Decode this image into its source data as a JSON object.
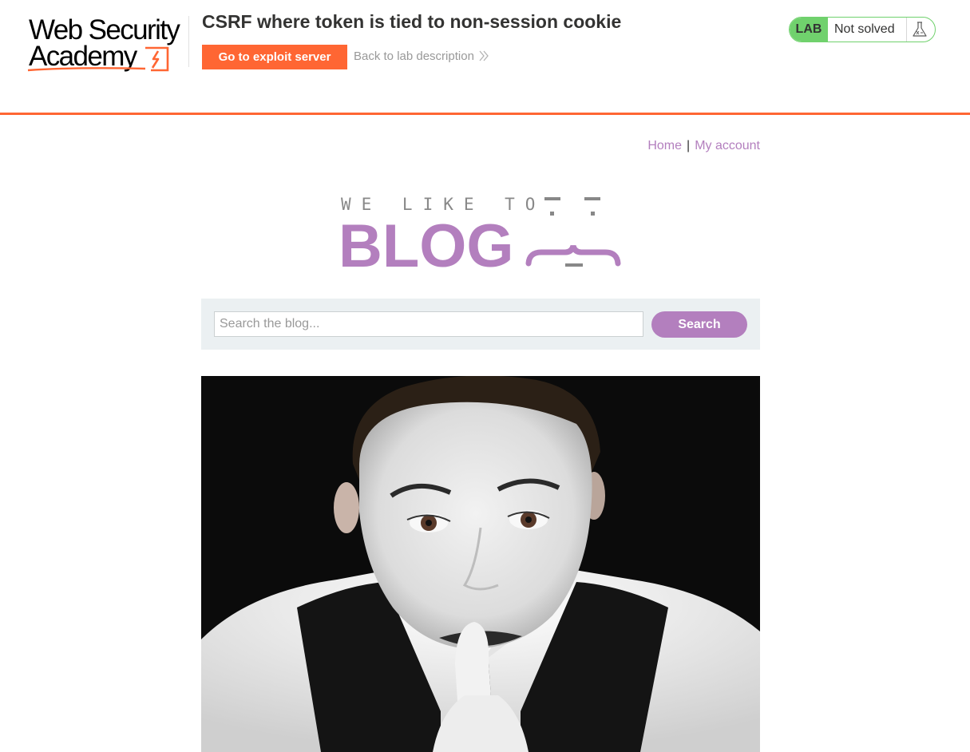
{
  "header": {
    "logo_text_line1": "Web Security",
    "logo_text_line2": "Academy",
    "lab_title": "CSRF where token is tied to non-session cookie",
    "exploit_button": "Go to exploit server",
    "back_link": "Back to lab description",
    "lab_badge": "LAB",
    "lab_status": "Not solved",
    "colors": {
      "accent": "#ff6633",
      "solved_green": "#70d16d"
    }
  },
  "nav": {
    "home": "Home",
    "separator": "|",
    "account": "My account",
    "link_color": "#b37fbe"
  },
  "banner": {
    "tagline": "WE LIKE TO",
    "title": "BLOG"
  },
  "search": {
    "placeholder": "Search the blog...",
    "value": "",
    "button": "Search"
  },
  "post": {
    "image_subject": "mime-shushing-photo"
  }
}
